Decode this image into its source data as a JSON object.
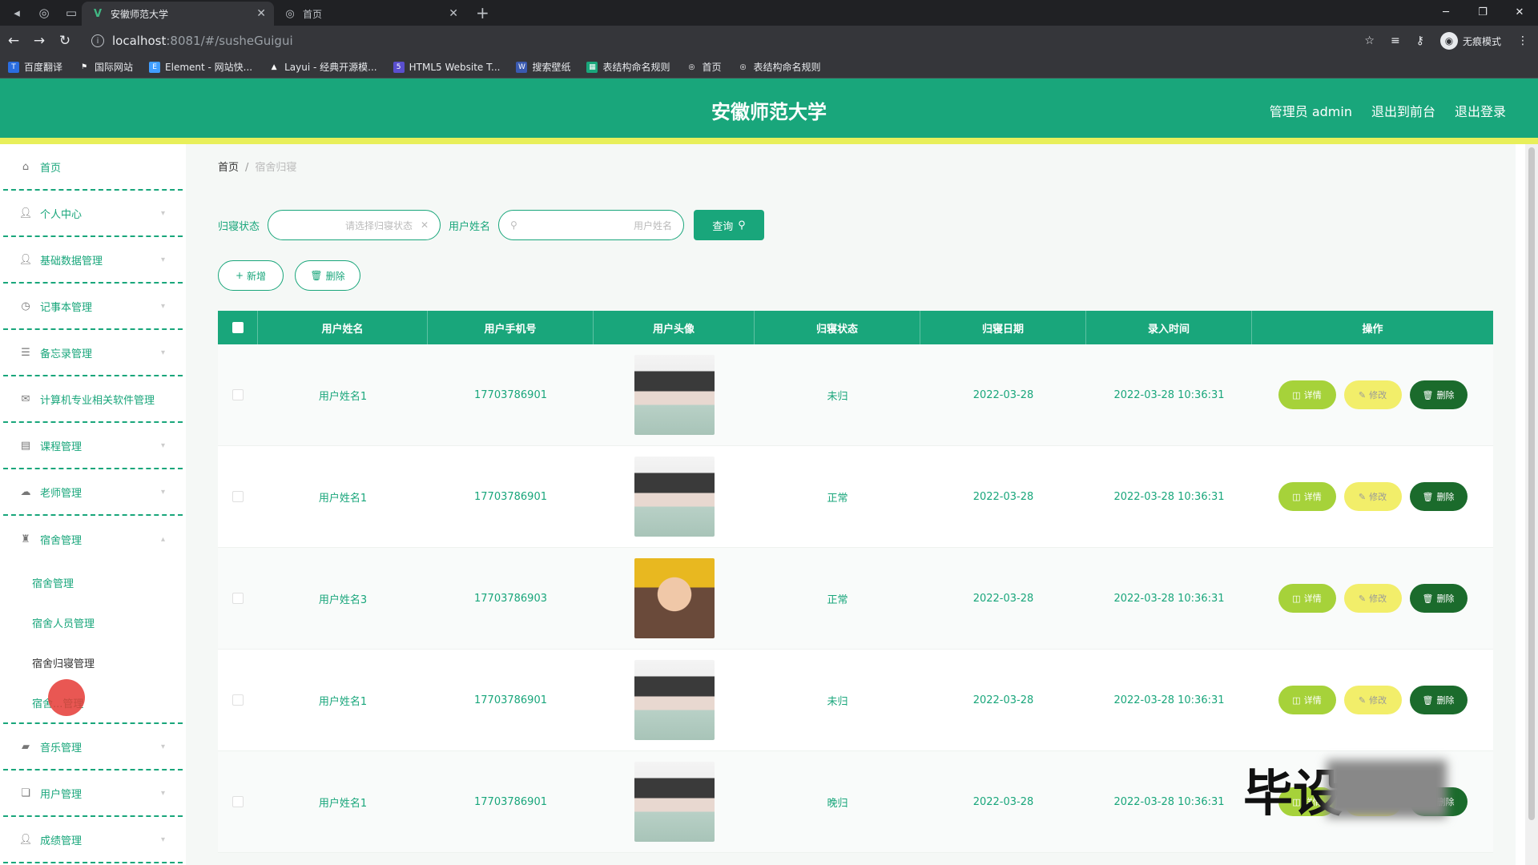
{
  "browser": {
    "tabs": [
      {
        "title": "安徽师范大学",
        "active": true
      },
      {
        "title": "首页",
        "active": false
      }
    ],
    "url_host": "localhost",
    "url_rest": ":8081/#/susheGuigui",
    "incognito_label": "无痕模式",
    "bookmarks": [
      "百度翻译",
      "国际网站",
      "Element - 网站快...",
      "Layui - 经典开源模...",
      "HTML5 Website T...",
      "搜索壁纸",
      "表结构命名规则",
      "首页",
      "表结构命名规则"
    ]
  },
  "header": {
    "title": "安徽师范大学",
    "admin": "管理员 admin",
    "back_front": "退出到前台",
    "logout": "退出登录"
  },
  "sidebar": {
    "items": [
      {
        "label": "首页",
        "icon": "home-icon"
      },
      {
        "label": "个人中心",
        "icon": "user-icon"
      },
      {
        "label": "基础数据管理",
        "icon": "user-icon"
      },
      {
        "label": "记事本管理",
        "icon": "clock-icon"
      },
      {
        "label": "备忘录管理",
        "icon": "list-icon"
      },
      {
        "label": "计算机专业相关软件管理",
        "icon": "mail-icon"
      },
      {
        "label": "课程管理",
        "icon": "box-icon"
      },
      {
        "label": "老师管理",
        "icon": "cloud-icon"
      },
      {
        "label": "宿舍管理",
        "icon": "cup-icon"
      }
    ],
    "sub_items": [
      "宿舍管理",
      "宿舍人员管理",
      "宿舍归寝管理",
      "宿舍...管理"
    ],
    "bottom_items": [
      {
        "label": "音乐管理",
        "icon": "chat-icon"
      },
      {
        "label": "用户管理",
        "icon": "doc-icon"
      },
      {
        "label": "成绩管理",
        "icon": "user-icon"
      }
    ]
  },
  "breadcrumb": {
    "home": "首页",
    "current": "宿舍归寝"
  },
  "search": {
    "status_label": "归寝状态",
    "status_placeholder": "请选择归寝状态",
    "name_label": "用户姓名",
    "name_placeholder": "用户姓名",
    "query_label": "查询"
  },
  "actions": {
    "add": "新增",
    "delete": "删除"
  },
  "table": {
    "headers": [
      "用户姓名",
      "用户手机号",
      "用户头像",
      "归寝状态",
      "归寝日期",
      "录入时间",
      "操作"
    ],
    "rows": [
      {
        "name": "用户姓名1",
        "phone": "17703786901",
        "avatar": "girl",
        "status": "未归",
        "date": "2022-03-28",
        "time": "2022-03-28 10:36:31"
      },
      {
        "name": "用户姓名1",
        "phone": "17703786901",
        "avatar": "girl",
        "status": "正常",
        "date": "2022-03-28",
        "time": "2022-03-28 10:36:31"
      },
      {
        "name": "用户姓名3",
        "phone": "17703786903",
        "avatar": "boy",
        "status": "正常",
        "date": "2022-03-28",
        "time": "2022-03-28 10:36:31"
      },
      {
        "name": "用户姓名1",
        "phone": "17703786901",
        "avatar": "girl",
        "status": "未归",
        "date": "2022-03-28",
        "time": "2022-03-28 10:36:31"
      },
      {
        "name": "用户姓名1",
        "phone": "17703786901",
        "avatar": "girl",
        "status": "晚归",
        "date": "2022-03-28",
        "time": "2022-03-28 10:36:31"
      }
    ],
    "op_detail": "详情",
    "op_edit": "修改",
    "op_delete": "删除"
  },
  "watermark": "毕设",
  "colors": {
    "brand": "#19a67b",
    "stripe": "#e8ef5a",
    "detail": "#a6d23a",
    "edit": "#f2ee6a",
    "delete": "#1b6b2c"
  }
}
